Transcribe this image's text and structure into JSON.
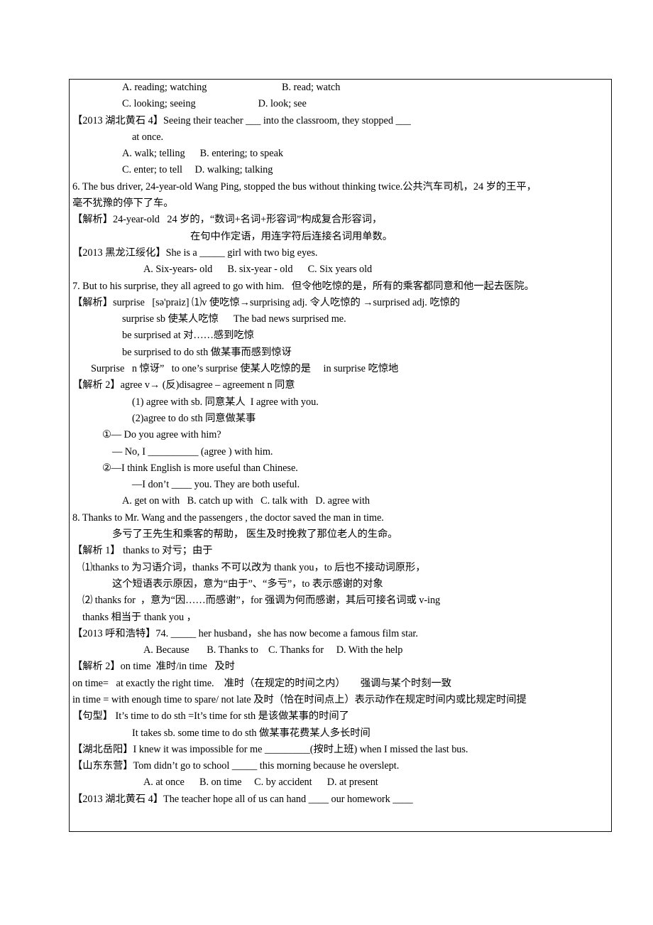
{
  "document": {
    "border_color": "#111111",
    "lines": [
      {
        "id": "l1",
        "indent": 5,
        "text": "A. reading; watching                              B. read; watch"
      },
      {
        "id": "l2",
        "indent": 5,
        "text": "C. looking; seeing                         D. look; see"
      },
      {
        "id": "l3",
        "indent": 0,
        "text": "【2013 湖北黄石 4】Seeing their teacher ___ into the classroom, they stopped ___"
      },
      {
        "id": "l4",
        "indent": 6,
        "text": "at once."
      },
      {
        "id": "l5",
        "indent": 5,
        "text": "A. walk; telling      B. entering; to speak"
      },
      {
        "id": "l6",
        "indent": 5,
        "text": "C. enter; to tell     D. walking; talking"
      },
      {
        "id": "l7",
        "indent": 0,
        "text": "6. The bus driver, 24-year-old Wang Ping, stopped the bus without thinking twice.公共汽车司机，24 岁的王平，"
      },
      {
        "id": "l8",
        "indent": 0,
        "text": "毫不犹豫的停下了车。"
      },
      {
        "id": "l9",
        "indent": 0,
        "text": "【解析】24-year-old   24 岁的，“数词+名词+形容词”构成复合形容词，"
      },
      {
        "id": "l10",
        "indent": 9,
        "text": "在句中作定语，用连字符后连接名词用单数。"
      },
      {
        "id": "l11",
        "indent": 0,
        "text": "【2013 黑龙江绥化】She is a _____ girl with two big eyes."
      },
      {
        "id": "l12",
        "indent": 7,
        "text": "A. Six-years- old      B. six-year - old      C. Six years old"
      },
      {
        "id": "l13",
        "indent": 0,
        "text": "7. But to his surprise, they all agreed to go with him.   但令他吃惊的是，所有的乘客都同意和他一起去医院。"
      },
      {
        "id": "l14",
        "indent": 0,
        "text": "【解析】surprise   [sə'praiz] ⑴v 使吃惊→surprising adj. 令人吃惊的 →surprised adj. 吃惊的"
      },
      {
        "id": "l15",
        "indent": 5,
        "text": "surprise sb 使某人吃惊      The bad news surprised me."
      },
      {
        "id": "l16",
        "indent": 5,
        "text": "be surprised at 对……感到吃惊"
      },
      {
        "id": "l17",
        "indent": 5,
        "text": "be surprised to do sth 做某事而感到惊讶"
      },
      {
        "id": "l18",
        "indent": 2,
        "text": "Surprise   n 惊讶”   to one’s surprise 使某人吃惊的是     in surprise 吃惊地"
      },
      {
        "id": "l19",
        "indent": 0,
        "text": "【解析 2】agree v→ (反)disagree – agreement n 同意"
      },
      {
        "id": "l20",
        "indent": 6,
        "text": "(1) agree with sb. 同意某人  I agree with you."
      },
      {
        "id": "l21",
        "indent": 6,
        "text": "(2)agree to do sth 同意做某事"
      },
      {
        "id": "l22",
        "indent": 3,
        "text": "①— Do you agree with him?"
      },
      {
        "id": "l23",
        "indent": 4,
        "text": "— No, I __________ (agree ) with him."
      },
      {
        "id": "l24",
        "indent": 3,
        "text": "②—I think English is more useful than Chinese."
      },
      {
        "id": "l25",
        "indent": 6,
        "text": "—I don’t ____ you. They are both useful."
      },
      {
        "id": "l26",
        "indent": 5,
        "text": "A. get on with   B. catch up with   C. talk with   D. agree with"
      },
      {
        "id": "l27",
        "indent": 0,
        "text": "8. Thanks to Mr. Wang and the passengers , the doctor saved the man in time."
      },
      {
        "id": "l28",
        "indent": 4,
        "text": "多亏了王先生和乘客的帮助， 医生及时挽救了那位老人的生命。"
      },
      {
        "id": "l29",
        "indent": 0,
        "text": "【解析 1】 thanks to 对亏；由于"
      },
      {
        "id": "l30",
        "indent": 1,
        "text": "⑴thanks to 为习语介词，thanks 不可以改为 thank you，to 后也不接动词原形，"
      },
      {
        "id": "l31",
        "indent": 4,
        "text": "这个短语表示原因，意为“由于”、“多亏”，to 表示感谢的对象"
      },
      {
        "id": "l32",
        "indent": 1,
        "text": "⑵ thanks for  ，意为“因……而感谢”，for 强调为何而感谢，其后可接名词或 v-ing"
      },
      {
        "id": "l33",
        "indent": 1,
        "text": "thanks 相当于 thank you ，"
      },
      {
        "id": "l34",
        "indent": 0,
        "text": "【2013 呼和浩特】74. _____ her husband，she has now become a famous film star."
      },
      {
        "id": "l35",
        "indent": 7,
        "text": "A. Because       B. Thanks to    C. Thanks for     D. With the help"
      },
      {
        "id": "l36",
        "indent": 0,
        "text": "【解析 2】on time  准时/in time   及时"
      },
      {
        "id": "l37",
        "indent": 0,
        "text": "on time=   at exactly the right time.    准时（在规定的时间之内）      强调与某个时刻一致"
      },
      {
        "id": "l38",
        "indent": 0,
        "text": "in time = with enough time to spare/ not late 及时（恰在时间点上）表示动作在规定时间内或比规定时间提"
      },
      {
        "id": "l39",
        "indent": 0,
        "text": "【句型】 It’s time to do sth =It’s time for sth 是该做某事的时间了"
      },
      {
        "id": "l40",
        "indent": 6,
        "text": "It takes sb. some time to do sth 做某事花费某人多长时间"
      },
      {
        "id": "l41",
        "indent": 0,
        "text": "【湖北岳阳】I knew it was impossible for me _________(按时上班) when I missed the last bus."
      },
      {
        "id": "l42",
        "indent": 0,
        "text": "【山东东营】Tom didn’t go to school _____ this morning because he overslept."
      },
      {
        "id": "l43",
        "indent": 7,
        "text": "A. at once      B. on time     C. by accident      D. at present"
      },
      {
        "id": "l44",
        "indent": 0,
        "text": "【2013 湖北黄石 4】The teacher hope all of us can hand ____ our homework ____"
      }
    ]
  }
}
